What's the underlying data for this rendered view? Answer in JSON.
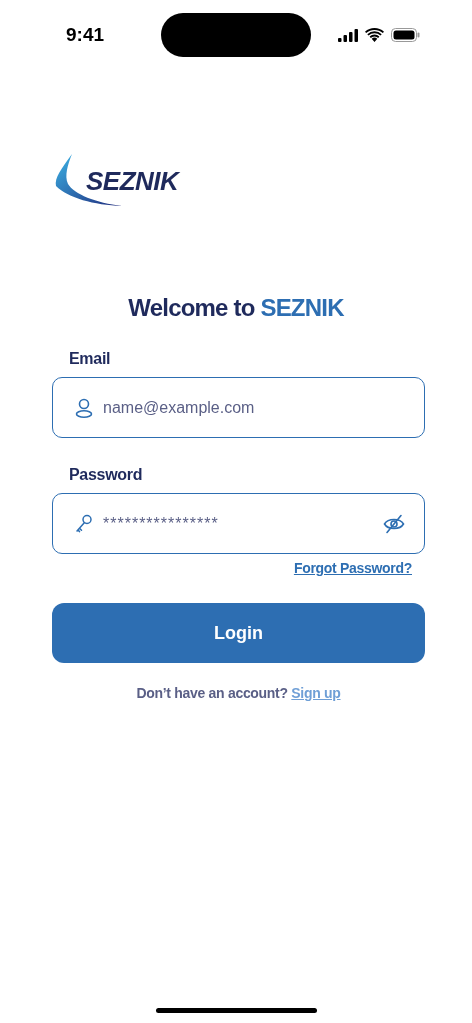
{
  "status_bar": {
    "time": "9:41"
  },
  "logo": {
    "text": "SEZNIK"
  },
  "title": {
    "lead": "Welcome to",
    "brand": "SEZNIK"
  },
  "fields": [
    {
      "kind": "email",
      "label": "Email",
      "placeholder": "name@example.com"
    },
    {
      "kind": "password",
      "label": "Password",
      "value": "****************"
    }
  ],
  "forgot_link": "Forgot Password?",
  "login_button": "Login",
  "signup": {
    "prompt": "Don’t have an account?",
    "link": "Sign up"
  }
}
